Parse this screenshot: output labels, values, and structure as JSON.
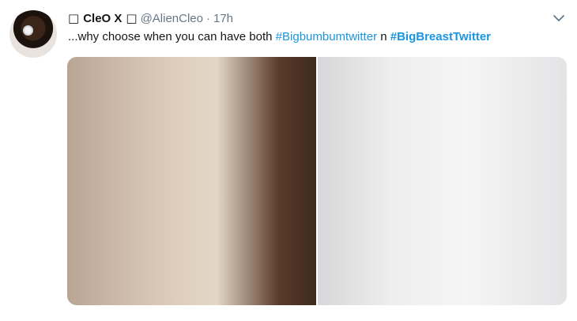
{
  "tweet": {
    "display_name": "CleO X",
    "name_prefix_glyph": "□",
    "name_suffix_glyph": "□",
    "handle": "@AlienCleo",
    "separator": "·",
    "time": "17h",
    "text_plain": "...why choose when you can have both ",
    "hashtag_1": "#Bigbumbumtwitter",
    "text_mid": " n ",
    "hashtag_2": "#BigBreastTwitter",
    "caret_icon": "chevron-down-icon",
    "colors": {
      "link": "#1b95e0",
      "muted": "#657786",
      "text": "#14171a"
    }
  },
  "media": {
    "count": 2,
    "photos": [
      {
        "icon": "photo-icon",
        "label": ""
      },
      {
        "icon": "photo-icon",
        "label": ""
      }
    ]
  }
}
